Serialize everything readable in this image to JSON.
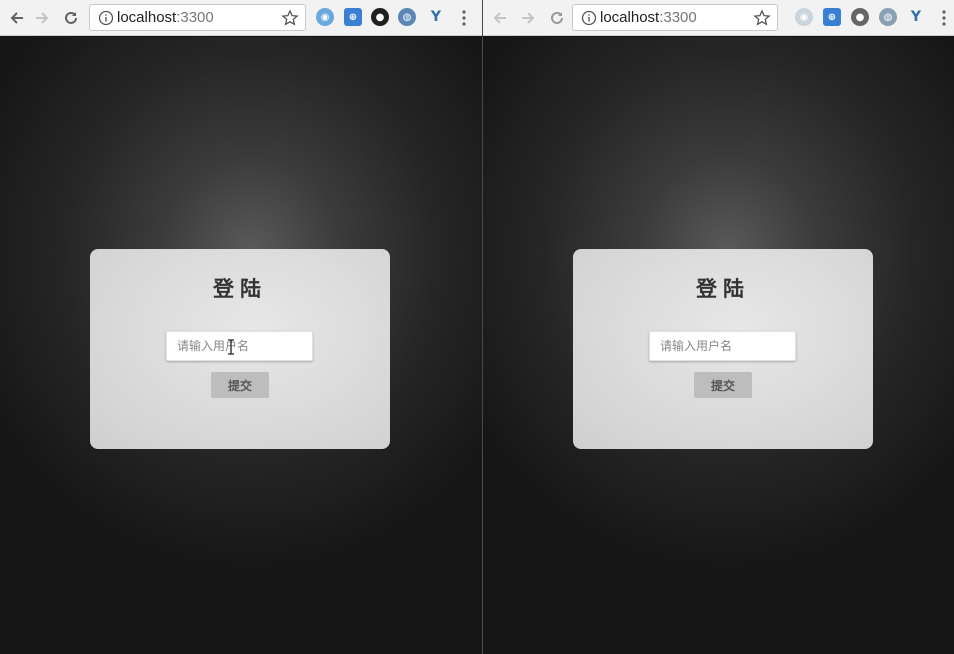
{
  "windows": [
    {
      "id": "left",
      "address": {
        "host": "localhost",
        "port": ":3300"
      },
      "extensions": [
        {
          "name": "safari-compass-icon",
          "color": "#6aa9de",
          "glyph": "◉"
        },
        {
          "name": "archive-badge-icon",
          "color": "#3b7fd4",
          "glyph": "⊕"
        },
        {
          "name": "camera-lens-icon",
          "color": "#1f1f1f",
          "glyph": "●"
        },
        {
          "name": "globe-icon",
          "color": "#5b87b5",
          "glyph": "◍"
        },
        {
          "name": "vue-devtools-icon",
          "color": "#2f6fb0",
          "glyph": "Y"
        }
      ],
      "login": {
        "title": "登陆",
        "username_placeholder": "请输入用户名",
        "username_value": "",
        "submit_label": "提交"
      }
    },
    {
      "id": "right",
      "address": {
        "host": "localhost",
        "port": ":3300"
      },
      "extensions": [
        {
          "name": "safari-compass-icon",
          "color": "#c9d4dd",
          "glyph": "◉"
        },
        {
          "name": "archive-badge-icon",
          "color": "#3b7fd4",
          "glyph": "⊕"
        },
        {
          "name": "camera-lens-icon",
          "color": "#666666",
          "glyph": "●"
        },
        {
          "name": "globe-icon",
          "color": "#8aa0b5",
          "glyph": "◍"
        },
        {
          "name": "vue-devtools-icon",
          "color": "#2f6fb0",
          "glyph": "Y"
        }
      ],
      "login": {
        "title": "登陆",
        "username_placeholder": "请输入用户名",
        "username_value": "",
        "submit_label": "提交"
      }
    }
  ]
}
